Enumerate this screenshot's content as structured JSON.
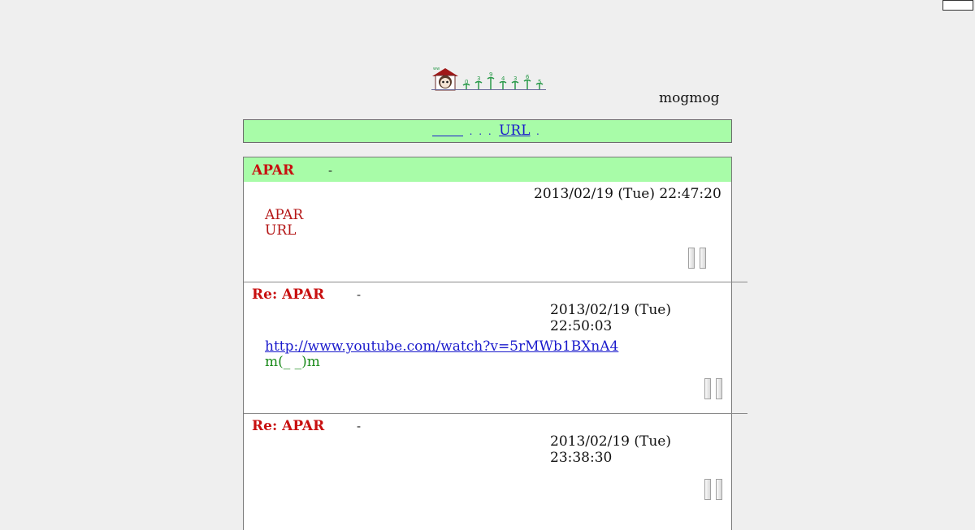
{
  "header": {
    "counter_digits": [
      "0",
      "3",
      "9",
      "4",
      "3",
      "6",
      "5"
    ],
    "user_name": "mogmog"
  },
  "nav": {
    "links": [
      "URL"
    ]
  },
  "posts": [
    {
      "title": "APAR",
      "dash": "-",
      "date": "2013/02/19 (Tue) 22:47:20",
      "lines": [
        "APAR",
        "URL"
      ]
    },
    {
      "title": "Re: APAR",
      "dash": "-",
      "date": "2013/02/19 (Tue) 22:50:03",
      "link": "http://www.youtube.com/watch?v=5rMWb1BXnA4",
      "lines": [
        "m(_ _)m"
      ]
    },
    {
      "title": "Re: APAR",
      "dash": "-",
      "date": "2013/02/19 (Tue) 23:38:30",
      "lines": []
    }
  ],
  "colors": {
    "page_bg": "#efefef",
    "header_green": "#a8fca8",
    "title_red": "#c81010",
    "link_blue": "#1a1acc",
    "text_green": "#1a8a1a"
  }
}
